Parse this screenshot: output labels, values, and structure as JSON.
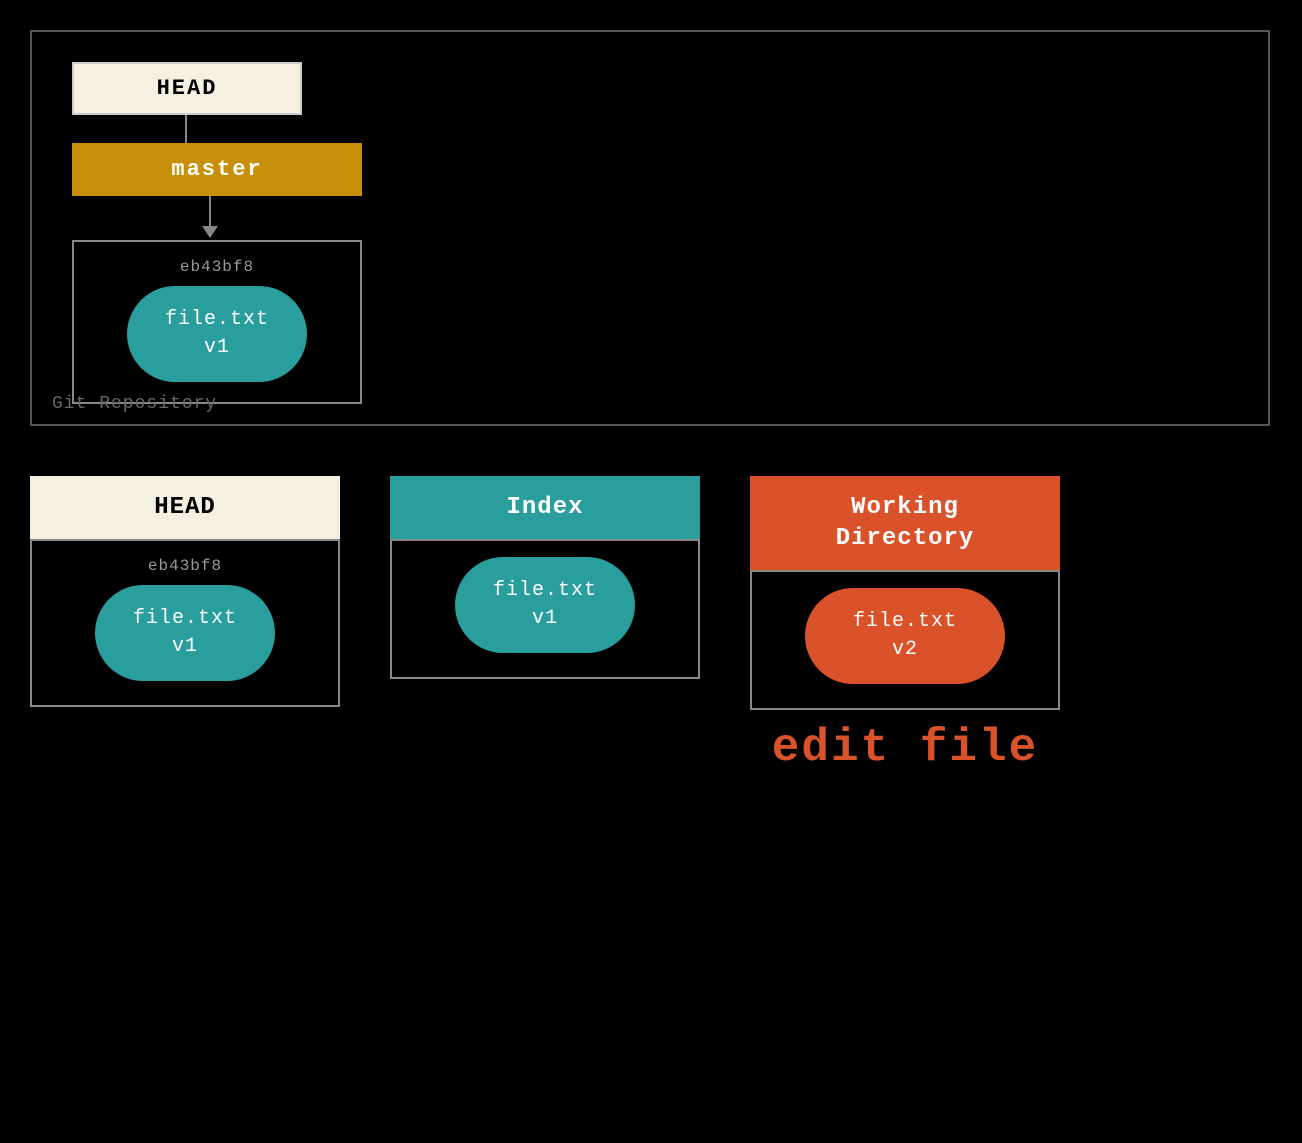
{
  "colors": {
    "background": "#000000",
    "head_bg": "#f5f0e0",
    "master_bg": "#c8900a",
    "teal": "#2a9d9d",
    "orange": "#d9522a",
    "border": "#888888",
    "label_gray": "#666666"
  },
  "git_repo": {
    "label": "Git Repository",
    "head_label": "HEAD",
    "master_label": "master",
    "commit_hash": "eb43bf8",
    "blob_line1": "file.txt",
    "blob_line2": "v1"
  },
  "bottom": {
    "head_col": {
      "header": "HEAD",
      "commit_hash": "eb43bf8",
      "blob_line1": "file.txt",
      "blob_line2": "v1"
    },
    "index_col": {
      "header": "Index",
      "blob_line1": "file.txt",
      "blob_line2": "v1"
    },
    "working_col": {
      "header": "Working\nDirectory",
      "blob_line1": "file.txt",
      "blob_line2": "v2",
      "action_label": "edit file"
    }
  }
}
